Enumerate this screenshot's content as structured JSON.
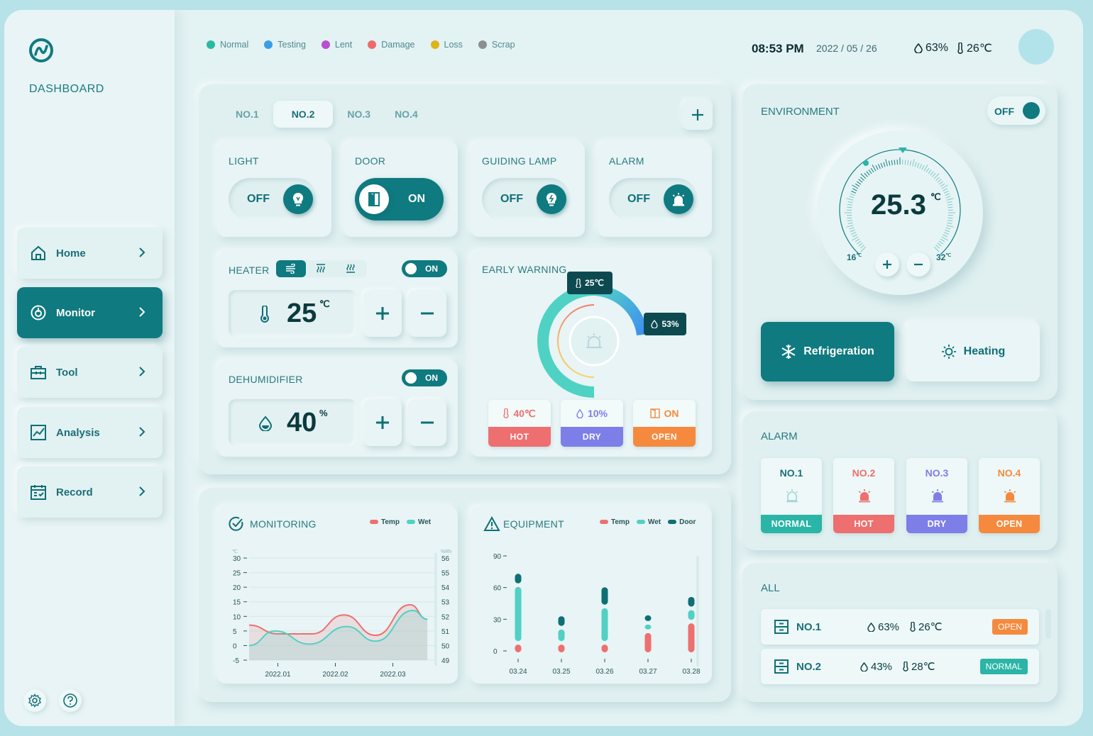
{
  "app": {
    "brand": "DASHBOARD"
  },
  "sidebar": {
    "items": [
      {
        "label": "Home"
      },
      {
        "label": "Monitor"
      },
      {
        "label": "Tool"
      },
      {
        "label": "Analysis"
      },
      {
        "label": "Record"
      }
    ],
    "bottom_icons": [
      "settings-icon",
      "help-icon"
    ]
  },
  "legend": [
    {
      "label": "Normal",
      "color": "#2bb9a4"
    },
    {
      "label": "Testing",
      "color": "#3b9ce8"
    },
    {
      "label": "Lent",
      "color": "#b84fd0"
    },
    {
      "label": "Damage",
      "color": "#ee6a6a"
    },
    {
      "label": "Loss",
      "color": "#dfb417"
    },
    {
      "label": "Scrap",
      "color": "#8a8f90"
    }
  ],
  "header": {
    "time": "08:53 PM",
    "date": "2022 / 05 / 26",
    "humidity": "63%",
    "temperature": "26℃"
  },
  "tabs": [
    "NO.1",
    "NO.2",
    "NO.3",
    "NO.4"
  ],
  "devices": {
    "light": {
      "title": "LIGHT",
      "state": "OFF"
    },
    "door": {
      "title": "DOOR",
      "state": "ON"
    },
    "guiding_lamp": {
      "title": "GUIDING LAMP",
      "state": "OFF"
    },
    "alarm": {
      "title": "ALARM",
      "state": "OFF"
    }
  },
  "heater": {
    "title": "HEATER",
    "toggle": "ON",
    "value": "25",
    "unit": "℃"
  },
  "dehumidifier": {
    "title": "DEHUMIDIFIER",
    "toggle": "ON",
    "value": "40",
    "unit": "%"
  },
  "early_warning": {
    "title": "EARLY WARNING",
    "temp_tag": "25℃",
    "hum_tag": "53%",
    "status": [
      {
        "value": "40℃",
        "label": "HOT",
        "color": "#ee6f6f"
      },
      {
        "value": "10%",
        "label": "DRY",
        "color": "#7e7ee8"
      },
      {
        "value": "ON",
        "label": "OPEN",
        "color": "#f58a3e"
      }
    ]
  },
  "environment": {
    "title": "ENVIRONMENT",
    "toggle": "OFF",
    "value": "25.3",
    "unit": "℃",
    "min": "16",
    "max": "32",
    "min_unit": "℃",
    "max_unit": "℃",
    "modes": {
      "refrigeration": "Refrigeration",
      "heating": "Heating"
    }
  },
  "alarm_panel": {
    "title": "ALARM",
    "items": [
      {
        "name": "NO.1",
        "status": "NORMAL",
        "color": "#2ab5a6",
        "name_color": "#1b6f77"
      },
      {
        "name": "NO.2",
        "status": "HOT",
        "color": "#ee6f6f",
        "name_color": "#ee6f6f"
      },
      {
        "name": "NO.3",
        "status": "DRY",
        "color": "#7e7ee8",
        "name_color": "#7e7ee8"
      },
      {
        "name": "NO.4",
        "status": "OPEN",
        "color": "#f58a3e",
        "name_color": "#f58a3e"
      }
    ]
  },
  "all_panel": {
    "title": "ALL",
    "rows": [
      {
        "name": "NO.1",
        "humidity": "63%",
        "temperature": "26℃",
        "status": "OPEN",
        "color": "#f58a3e"
      },
      {
        "name": "NO.2",
        "humidity": "43%",
        "temperature": "28℃",
        "status": "NORMAL",
        "color": "#2ab5a6"
      }
    ]
  },
  "monitoring": {
    "title": "MONITORING",
    "legend": [
      {
        "label": "Temp",
        "color": "#ee6f6f"
      },
      {
        "label": "Wet",
        "color": "#52d0c4"
      }
    ],
    "left_unit": "℃",
    "right_unit": "%Rh",
    "y_ticks": [
      "30",
      "25",
      "20",
      "15",
      "10",
      "5",
      "0",
      "-5"
    ],
    "r_ticks": [
      "56",
      "55",
      "54",
      "53",
      "52",
      "51",
      "50",
      "49"
    ],
    "x_ticks": [
      "2022.01",
      "2022.02",
      "2022.03"
    ]
  },
  "equipment": {
    "title": "EQUIPMENT",
    "legend": [
      {
        "label": "Temp",
        "color": "#ee6f6f"
      },
      {
        "label": "Wet",
        "color": "#52d0c4"
      },
      {
        "label": "Door",
        "color": "#0f6f76"
      }
    ],
    "y_ticks": [
      "90",
      "60",
      "30",
      "0"
    ],
    "x_ticks": [
      "03.24",
      "03.25",
      "03.26",
      "03.27",
      "03.28"
    ]
  },
  "chart_data": [
    {
      "type": "area",
      "title": "MONITORING",
      "x": [
        "2022.01",
        "2022.02",
        "2022.03"
      ],
      "ylim": [
        -5,
        30
      ],
      "y2lim": [
        49,
        56
      ],
      "series": [
        {
          "name": "Temp",
          "points": [
            [
              0,
              7
            ],
            [
              0.5,
              4
            ],
            [
              1.1,
              4
            ],
            [
              1.65,
              10.5
            ],
            [
              2.2,
              3.5
            ],
            [
              2.8,
              14
            ],
            [
              3.1,
              9
            ]
          ]
        },
        {
          "name": "Wet",
          "points": [
            [
              0,
              0
            ],
            [
              0.45,
              5
            ],
            [
              1.05,
              0.5
            ],
            [
              1.7,
              6.5
            ],
            [
              2.2,
              1.5
            ],
            [
              2.85,
              12
            ],
            [
              3.1,
              9
            ]
          ]
        }
      ]
    },
    {
      "type": "bar",
      "title": "EQUIPMENT",
      "categories": [
        "03.24",
        "03.25",
        "03.26",
        "03.27",
        "03.28"
      ],
      "ylim": [
        0,
        100
      ],
      "series": [
        {
          "name": "Temp",
          "values": [
            8,
            8,
            8,
            20,
            30
          ]
        },
        {
          "name": "Wet",
          "values": [
            56,
            12,
            34,
            5,
            10
          ]
        },
        {
          "name": "Door",
          "values": [
            10,
            10,
            18,
            6,
            10
          ]
        }
      ]
    }
  ]
}
